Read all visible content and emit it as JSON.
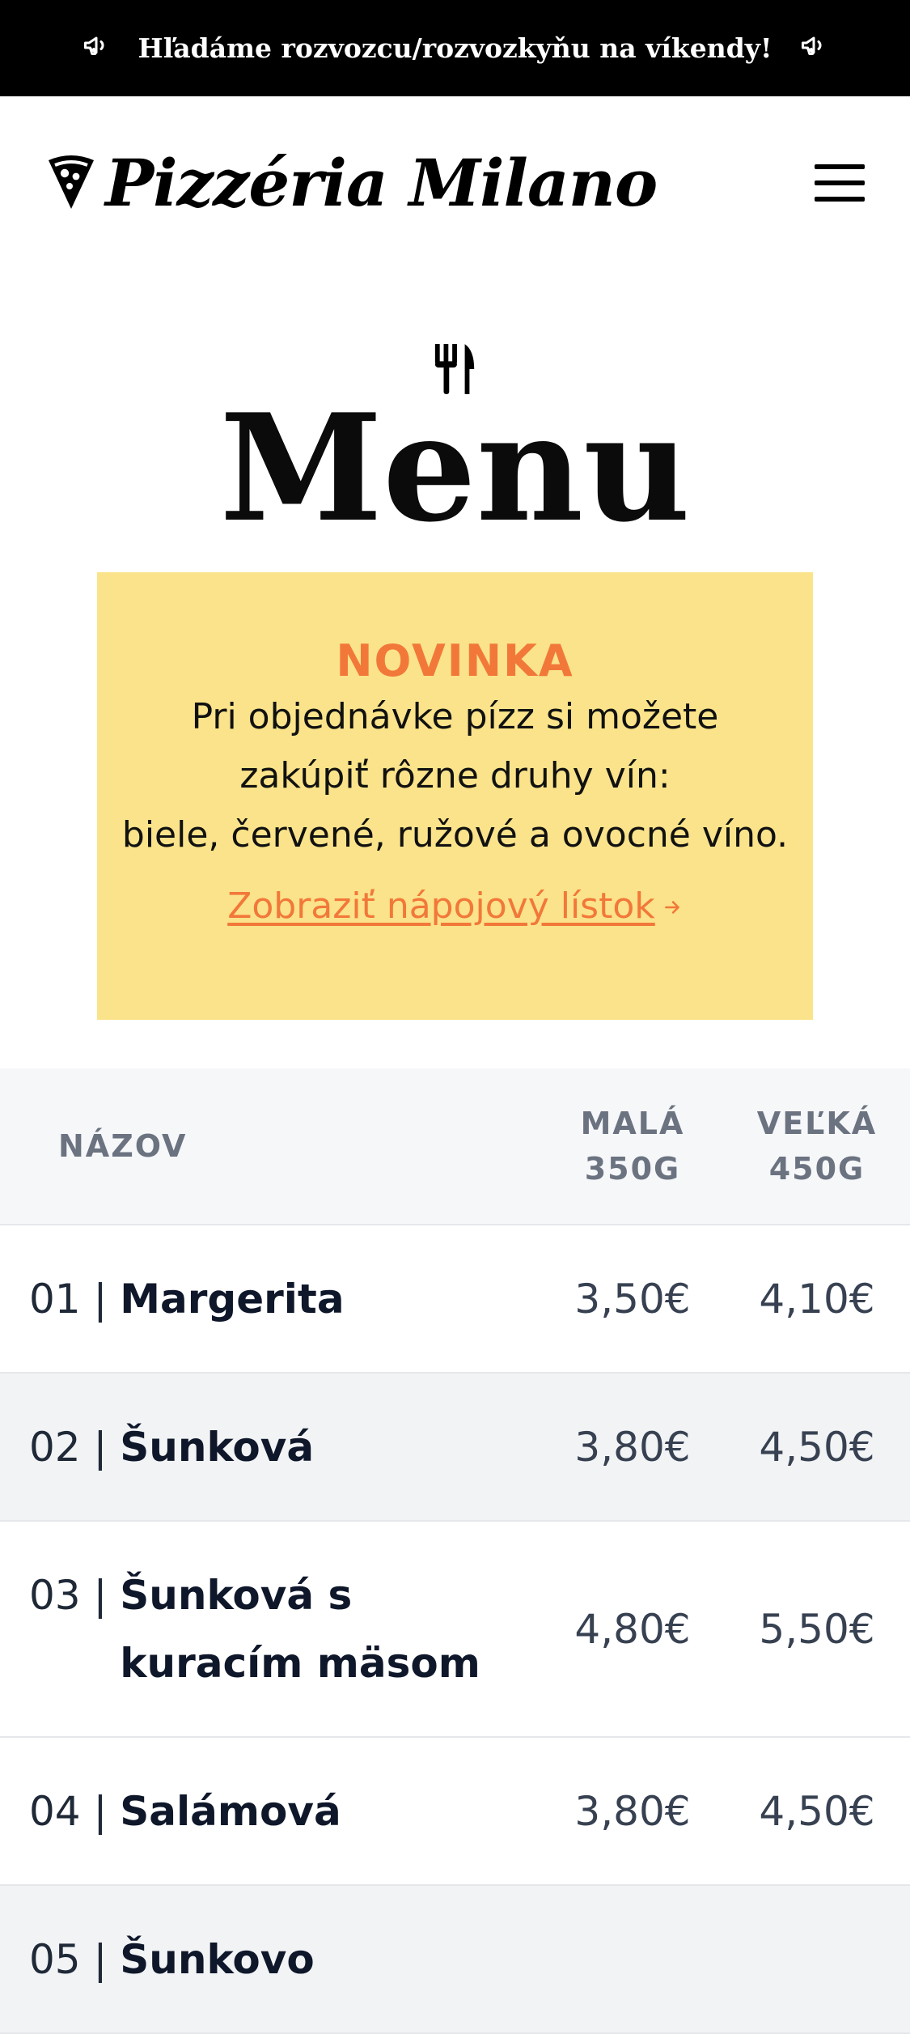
{
  "announcement": {
    "text": "Hľadáme rozvozcu/rozvozkyňu na víkendy!",
    "icon_left": "megaphone-icon",
    "icon_right": "megaphone-icon"
  },
  "header": {
    "brand": "Pizzéria Milano",
    "logo_icon": "pizza-slice-icon",
    "menu_icon": "hamburger-menu-icon"
  },
  "page": {
    "icon": "utensils-icon",
    "title": "Menu"
  },
  "promo": {
    "title": "NOVINKA",
    "line1": "Pri objednávke pízz si možete",
    "line2": "zakúpiť rôzne druhy vín:",
    "line3": "biele, červené, ružové a ovocné víno.",
    "link": "Zobraziť nápojový lístok",
    "link_icon": "arrow-right-icon",
    "background": "#fae38a",
    "accent": "#f2783a"
  },
  "table": {
    "headers": {
      "name": "NÁZOV",
      "small_line1": "MALÁ",
      "small_line2": "350G",
      "large_line1": "VEĽKÁ",
      "large_line2": "450G"
    },
    "rows": [
      {
        "num": "01 | ",
        "name": "Margerita",
        "small": "3,50€",
        "large": "4,10€"
      },
      {
        "num": "02 | ",
        "name": "Šunková",
        "small": "3,80€",
        "large": "4,50€"
      },
      {
        "num": "03 | ",
        "name": "Šunková s kuracím mäsom",
        "small": "4,80€",
        "large": "5,50€"
      },
      {
        "num": "04 | ",
        "name": "Salámová",
        "small": "3,80€",
        "large": "4,50€"
      },
      {
        "num": "05 | ",
        "name": "Šunkovo",
        "small": "",
        "large": ""
      }
    ]
  }
}
